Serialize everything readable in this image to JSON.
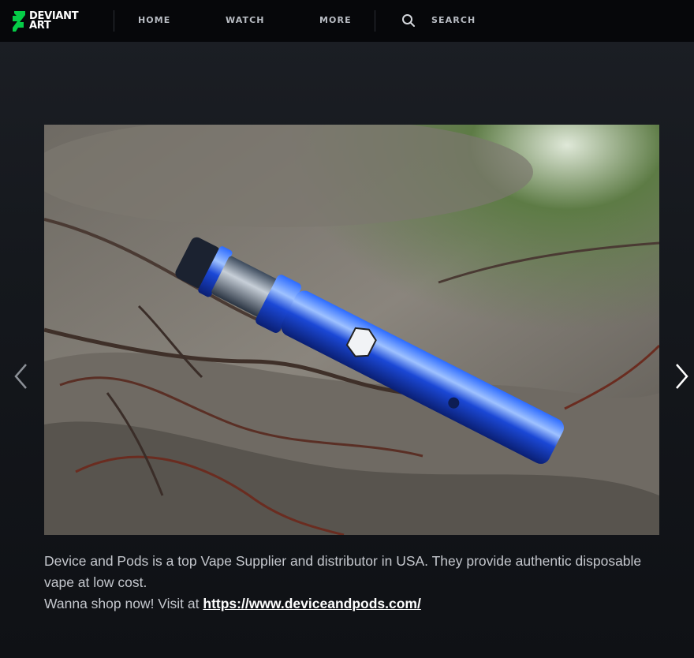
{
  "header": {
    "logo": {
      "line1": "DEVIANT",
      "line2": "ART",
      "accent_color": "#05cc47"
    },
    "nav": [
      {
        "label": "HOME"
      },
      {
        "label": "WATCH"
      },
      {
        "label": "MORE"
      }
    ],
    "search_label": "SEARCH"
  },
  "viewer": {
    "prev_icon": "chevron-left-icon",
    "next_icon": "chevron-right-icon"
  },
  "caption": {
    "line1": "Device and Pods is a top Vape Supplier and distributor in USA. They provide authentic disposable vape at low cost.",
    "line2_prefix": "Wanna shop now! Visit at ",
    "link_text": "https://www.deviceandpods.com/"
  },
  "colors": {
    "topbar_bg": "#06070a",
    "page_bg": "#15181d",
    "link": "#ffffff"
  }
}
